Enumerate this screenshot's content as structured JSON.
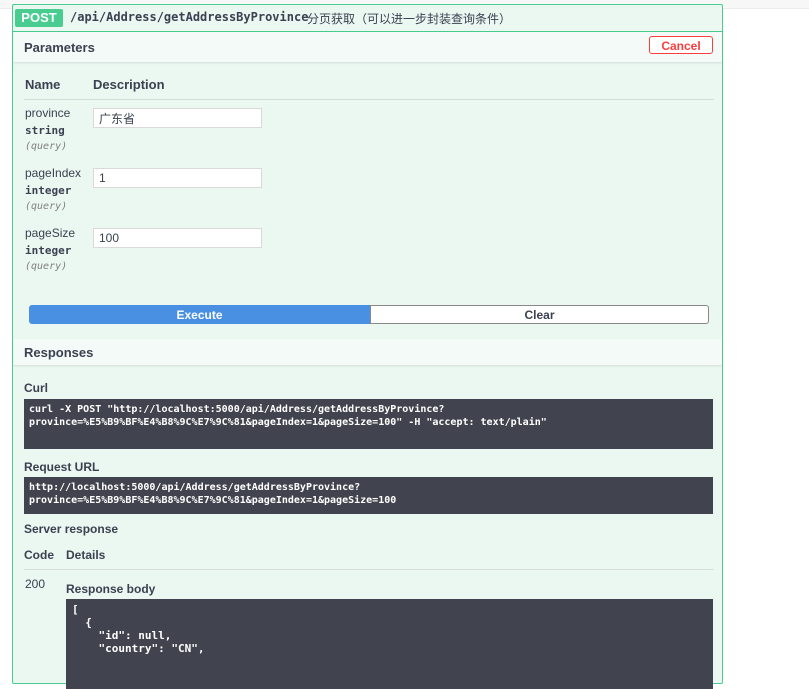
{
  "operation": {
    "method": "POST",
    "path": "/api/Address/getAddressByProvince",
    "summary": "分页获取（可以进一步封装查询条件）"
  },
  "parameters": {
    "title": "Parameters",
    "cancel_label": "Cancel",
    "col_name": "Name",
    "col_description": "Description",
    "items": [
      {
        "name": "province",
        "type": "string",
        "in": "(query)",
        "value": "广东省"
      },
      {
        "name": "pageIndex",
        "type": "integer",
        "in": "(query)",
        "value": "1"
      },
      {
        "name": "pageSize",
        "type": "integer",
        "in": "(query)",
        "value": "100"
      }
    ],
    "execute_label": "Execute",
    "clear_label": "Clear"
  },
  "responses": {
    "title": "Responses",
    "curl_label": "Curl",
    "curl_text": "curl -X POST \"http://localhost:5000/api/Address/getAddressByProvince?\nprovince=%E5%B9%BF%E4%B8%9C%E7%9C%81&pageIndex=1&pageSize=100\" -H \"accept: text/plain\"",
    "request_url_label": "Request URL",
    "request_url": "http://localhost:5000/api/Address/getAddressByProvince?\nprovince=%E5%B9%BF%E4%B8%9C%E7%9C%81&pageIndex=1&pageSize=100",
    "server_response_label": "Server response",
    "col_code": "Code",
    "col_details": "Details",
    "status_code": "200",
    "response_body_label": "Response body",
    "response_body": "[\n  {\n    \"id\": null,\n    \"country\": \"CN\","
  },
  "colors": {
    "post_green": "#49cc90",
    "execute_blue": "#4990e2",
    "cancel_red": "#f93e3e",
    "code_bg": "#41444e"
  }
}
